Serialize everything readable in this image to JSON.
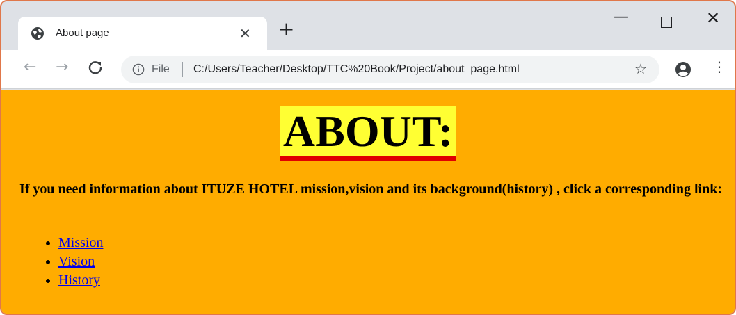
{
  "browser": {
    "tab": {
      "title": "About page",
      "close_glyph": "✕"
    },
    "new_tab_glyph": "+",
    "window_controls": {
      "minimize": "—",
      "close": "✕"
    },
    "nav": {
      "back": "←",
      "forward": "→",
      "reload": "C"
    },
    "omnibox": {
      "scheme_label": "File",
      "url": "C:/Users/Teacher/Desktop/TTC%20Book/Project/about_page.html",
      "star_glyph": "☆"
    },
    "menu_glyph": "⋮"
  },
  "page": {
    "background": "#ffac00",
    "heading": "ABOUT:",
    "heading_bg": "#ffff33",
    "heading_underline": "#e00000",
    "intro": "If you need information about ITUZE HOTEL mission,vision and its background(history) , click a corresponding link:",
    "links": [
      {
        "label": "Mission"
      },
      {
        "label": "Vision"
      },
      {
        "label": "History"
      }
    ]
  }
}
